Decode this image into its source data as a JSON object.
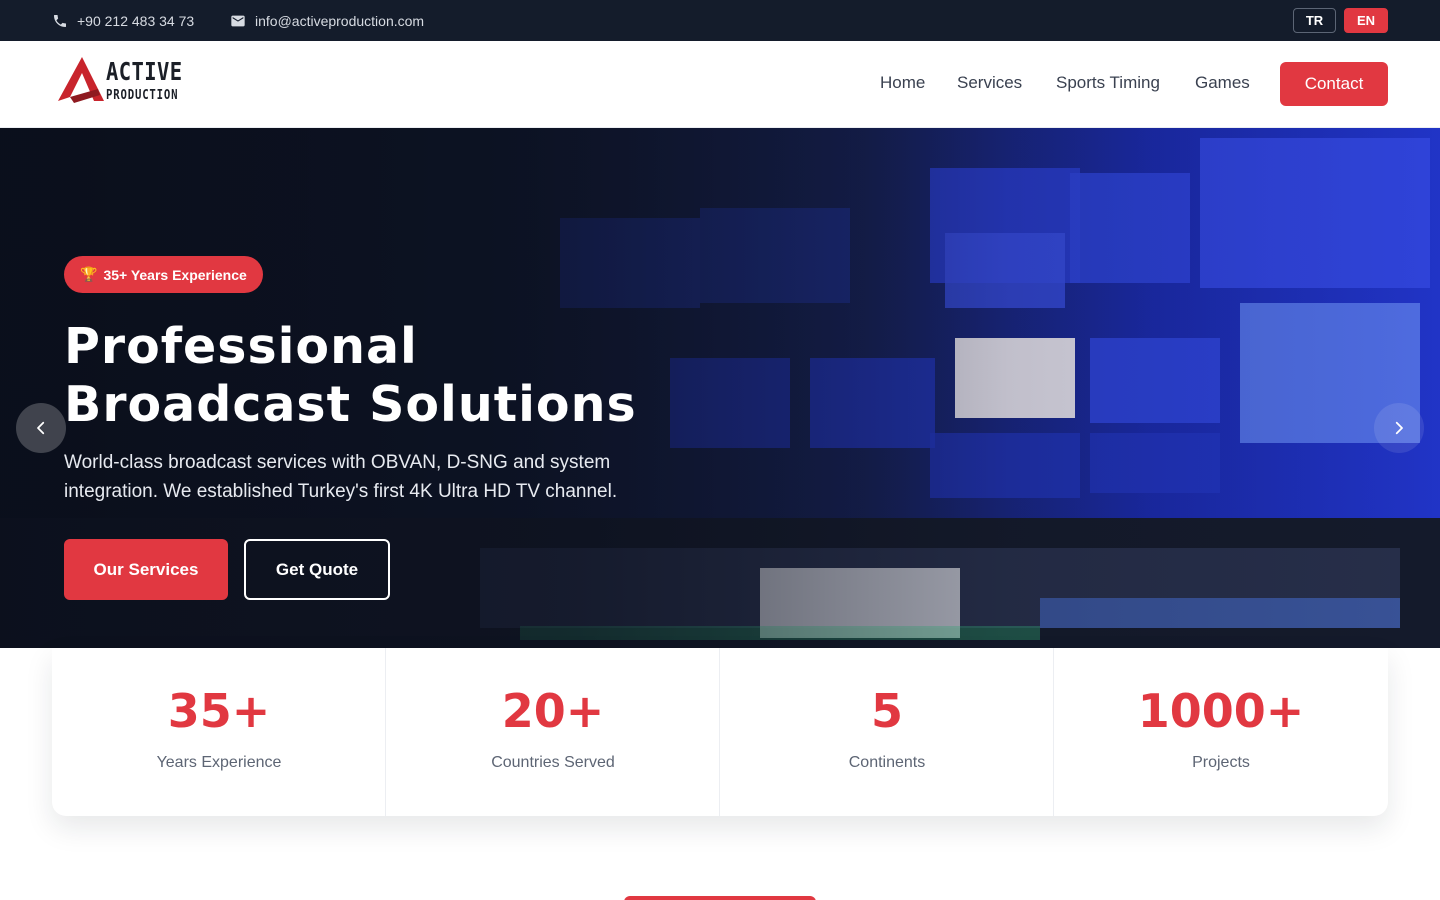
{
  "topbar": {
    "phone": "+90 212 483 34 73",
    "email": "info@activeproduction.com",
    "languages": [
      "TR",
      "EN"
    ],
    "active_language": "EN"
  },
  "brand": {
    "line1": "ACTIVE",
    "line2": "PRODUCTION",
    "accent": "#e13841"
  },
  "nav": {
    "items": [
      "Home",
      "Services",
      "Sports Timing",
      "Games"
    ],
    "contact": "Contact"
  },
  "hero": {
    "badge": "35+ Years Experience",
    "badge_icon": "trophy-icon",
    "title_line1": "Professional",
    "title_line2": "Broadcast Solutions",
    "description": "World-class broadcast services with OBVAN, D-SNG and system integration. We established Turkey's first 4K Ultra HD TV channel.",
    "primary_button": "Our Services",
    "secondary_button": "Get Quote"
  },
  "stats": [
    {
      "value": "35+",
      "label": "Years Experience"
    },
    {
      "value": "20+",
      "label": "Countries Served"
    },
    {
      "value": "5",
      "label": "Continents"
    },
    {
      "value": "1000+",
      "label": "Projects"
    }
  ],
  "colors": {
    "topbar_bg": "#141c2b",
    "accent": "#e13841",
    "text_muted": "#5d6574"
  }
}
